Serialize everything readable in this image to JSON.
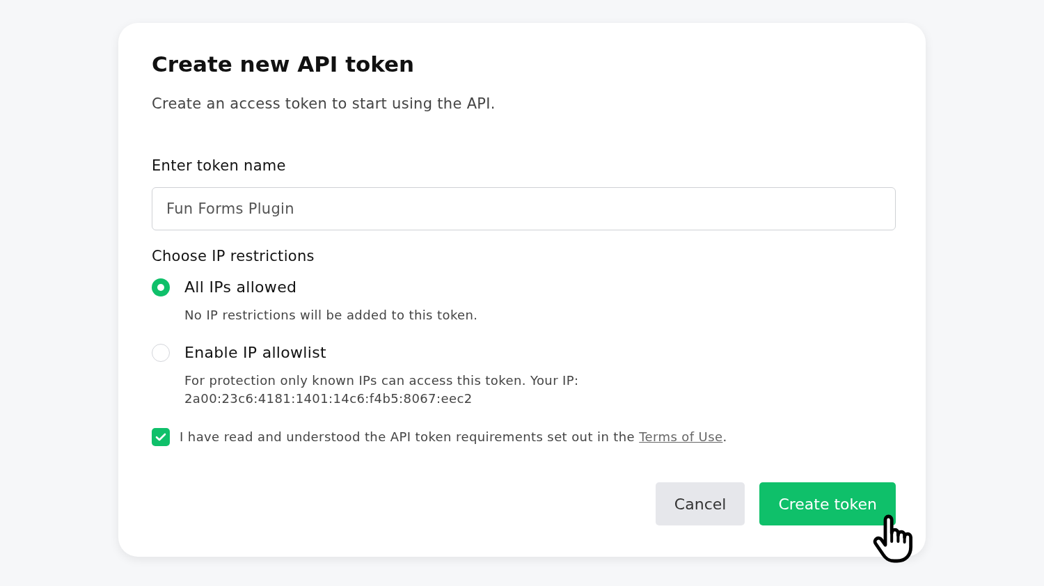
{
  "dialog": {
    "title": "Create new API token",
    "subtitle": "Create an access token to start using the API."
  },
  "token_name": {
    "label": "Enter token name",
    "value": "Fun Forms Plugin"
  },
  "ip_restrictions": {
    "label": "Choose IP restrictions",
    "options": [
      {
        "label": "All IPs allowed",
        "description": "No IP restrictions will be added to this token.",
        "selected": true
      },
      {
        "label": "Enable IP allowlist",
        "description": "For protection only known IPs can access this token. Your IP: 2a00:23c6:4181:1401:14c6:f4b5:8067:eec2",
        "selected": false
      }
    ]
  },
  "agreement": {
    "checked": true,
    "text": "I have read and understood the API token requirements set out in the ",
    "link": "Terms of Use",
    "suffix": "."
  },
  "buttons": [
    {
      "label": "Cancel",
      "kind": "secondary"
    },
    {
      "label": "Create token",
      "kind": "primary"
    }
  ]
}
